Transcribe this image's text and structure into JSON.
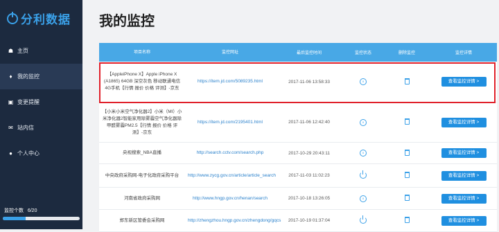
{
  "brand": {
    "name": "分利数据",
    "icon": "power-icon"
  },
  "nav": [
    {
      "label": "主页",
      "icon": "home-icon",
      "active": false
    },
    {
      "label": "我的监控",
      "icon": "bell-icon",
      "active": true
    },
    {
      "label": "变更提醒",
      "icon": "message-icon",
      "active": false
    },
    {
      "label": "站内信",
      "icon": "mail-icon",
      "active": false
    },
    {
      "label": "个人中心",
      "icon": "user-icon",
      "active": false
    }
  ],
  "quota": {
    "label": "监控个数",
    "value": "6/20",
    "fraction": 0.3
  },
  "page": {
    "title": "我的监控"
  },
  "table": {
    "headers": [
      "项目名称",
      "监控网址",
      "最后监控时间",
      "监控状态",
      "删除监控",
      "监控详情"
    ],
    "rows": [
      {
        "name": "【AppleiPhone X】Apple iPhone X (A1865) 64GB 深空灰色 移动联通电信4G手机【行情 报价 价格 评测】-京东",
        "url": "https://item.jd.com/5089235.html",
        "time": "2017-11-06 13:58:33",
        "status": "paused",
        "action": "查看监控详情 >"
      },
      {
        "name": "【小米小米空气净化器2】小米（MI）小米净化器2智能家用除雾霾空气净化器除甲醛雾霾PM2.5【行情 报价 价格 评测】-京东",
        "url": "https://item.jd.com/2195401.html",
        "time": "2017-11-06 12:42:40",
        "status": "paused",
        "action": "查看监控详情 >"
      },
      {
        "name": "央视搜索_NBA直播",
        "url": "http://search.cctv.com/search.php",
        "time": "2017-10-29 20:43:11",
        "status": "paused",
        "action": "查看监控详情 >"
      },
      {
        "name": "中央政府采购网-电子化政府采购平台",
        "url": "http://www.zycg.gov.cn/article/article_search",
        "time": "2017-11-03 11:02:23",
        "status": "running",
        "action": "查看监控详情 >"
      },
      {
        "name": "河南省政府采购网",
        "url": "http://www.hngp.gov.cn/henan/search",
        "time": "2017-10-18 13:26:05",
        "status": "paused",
        "action": "查看监控详情 >"
      },
      {
        "name": "郑东新区管委会采购网",
        "url": "http://zhengzhou.hngp.gov.cn/zhengdong/gqcs",
        "time": "2017-10-19 01:37:04",
        "status": "running",
        "action": "查看监控详情 >"
      }
    ]
  },
  "colors": {
    "sidebar": "#1c2a3f",
    "accent": "#3aa0e8",
    "header": "#48a8e6",
    "highlight": "#e0202a"
  }
}
